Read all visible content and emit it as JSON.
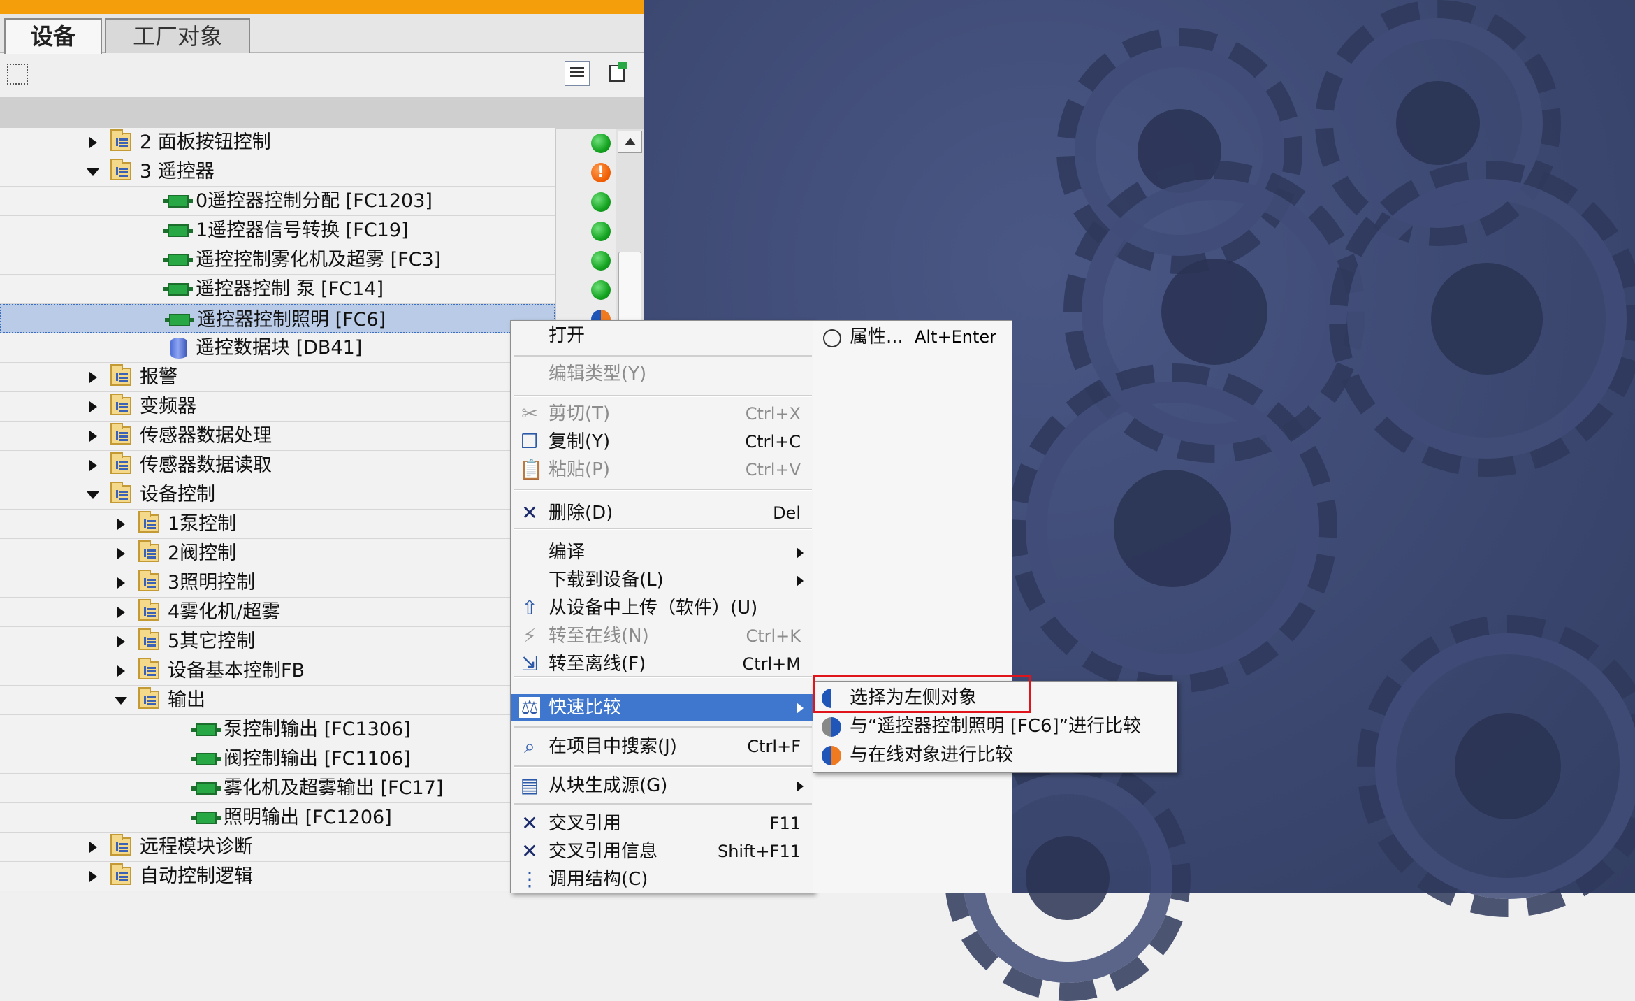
{
  "tabs": {
    "devices": "设备",
    "plant_objects": "工厂对象"
  },
  "tree": [
    {
      "label": "2 面板按钮控制",
      "kind": "folder",
      "level": 0,
      "expanded": false,
      "status": "ok"
    },
    {
      "label": "3 遥控器",
      "kind": "folder",
      "level": 0,
      "expanded": true,
      "status": "warning"
    },
    {
      "label": "0遥控器控制分配 [FC1203]",
      "kind": "fc",
      "level": 1,
      "status": "ok"
    },
    {
      "label": "1遥控器信号转换 [FC19]",
      "kind": "fc",
      "level": 1,
      "status": "ok"
    },
    {
      "label": "遥控控制雾化机及超雾 [FC3]",
      "kind": "fc",
      "level": 1,
      "status": "ok"
    },
    {
      "label": "遥控器控制 泵 [FC14]",
      "kind": "fc",
      "level": 1,
      "status": "ok"
    },
    {
      "label": "遥控器控制照明 [FC6]",
      "kind": "fc",
      "level": 1,
      "status": "half",
      "selected": true
    },
    {
      "label": "遥控数据块 [DB41]",
      "kind": "db",
      "level": 1
    },
    {
      "label": "报警",
      "kind": "folder",
      "level": 0,
      "expanded": false
    },
    {
      "label": "变频器",
      "kind": "folder",
      "level": 0,
      "expanded": false
    },
    {
      "label": "传感器数据处理",
      "kind": "folder",
      "level": 0,
      "expanded": false
    },
    {
      "label": "传感器数据读取",
      "kind": "folder",
      "level": 0,
      "expanded": false
    },
    {
      "label": "设备控制",
      "kind": "folder",
      "level": 0,
      "expanded": true
    },
    {
      "label": "1泵控制",
      "kind": "folder",
      "level": 1,
      "expanded": false
    },
    {
      "label": "2阀控制",
      "kind": "folder",
      "level": 1,
      "expanded": false
    },
    {
      "label": "3照明控制",
      "kind": "folder",
      "level": 1,
      "expanded": false
    },
    {
      "label": "4雾化机/超雾",
      "kind": "folder",
      "level": 1,
      "expanded": false
    },
    {
      "label": "5其它控制",
      "kind": "folder",
      "level": 1,
      "expanded": false
    },
    {
      "label": "设备基本控制FB",
      "kind": "folder",
      "level": 1,
      "expanded": false
    },
    {
      "label": "输出",
      "kind": "folder",
      "level": 1,
      "expanded": true
    },
    {
      "label": "泵控制输出 [FC1306]",
      "kind": "fc",
      "level": 2
    },
    {
      "label": "阀控制输出 [FC1106]",
      "kind": "fc",
      "level": 2
    },
    {
      "label": "雾化机及超雾输出 [FC17]",
      "kind": "fc",
      "level": 2
    },
    {
      "label": "照明输出 [FC1206]",
      "kind": "fc",
      "level": 2
    },
    {
      "label": "远程模块诊断",
      "kind": "folder",
      "level": 0,
      "expanded": false
    },
    {
      "label": "自动控制逻辑",
      "kind": "folder",
      "level": 0,
      "expanded": false
    }
  ],
  "context_menu": [
    {
      "label": "打开",
      "shortcut": "",
      "enabled": true
    },
    {
      "label": "编辑类型(Y)",
      "shortcut": "",
      "enabled": false
    },
    {
      "label": "剪切(T)",
      "shortcut": "Ctrl+X",
      "enabled": false,
      "icon": "scissors-icon"
    },
    {
      "label": "复制(Y)",
      "shortcut": "Ctrl+C",
      "enabled": true,
      "icon": "copy-icon"
    },
    {
      "label": "粘贴(P)",
      "shortcut": "Ctrl+V",
      "enabled": false,
      "icon": "paste-icon"
    },
    {
      "label": "删除(D)",
      "shortcut": "Del",
      "enabled": true,
      "icon": "delete-icon"
    },
    {
      "label": "编译",
      "shortcut": "",
      "enabled": true,
      "submenu": true
    },
    {
      "label": "下载到设备(L)",
      "shortcut": "",
      "enabled": true,
      "submenu": true
    },
    {
      "label": "从设备中上传（软件）(U)",
      "shortcut": "",
      "enabled": true,
      "icon": "upload-icon"
    },
    {
      "label": "转至在线(N)",
      "shortcut": "Ctrl+K",
      "enabled": false,
      "icon": "go-online-icon"
    },
    {
      "label": "转至离线(F)",
      "shortcut": "Ctrl+M",
      "enabled": true,
      "icon": "go-offline-icon"
    },
    {
      "label": "快速比较",
      "shortcut": "",
      "enabled": true,
      "submenu": true,
      "highlighted": true,
      "icon": "compare-scale-icon"
    },
    {
      "label": "在项目中搜索(J)",
      "shortcut": "Ctrl+F",
      "enabled": true,
      "icon": "search-project-icon"
    },
    {
      "label": "从块生成源(G)",
      "shortcut": "",
      "enabled": true,
      "submenu": true,
      "icon": "generate-source-icon"
    },
    {
      "label": "交叉引用",
      "shortcut": "F11",
      "enabled": true,
      "icon": "cross-reference-icon"
    },
    {
      "label": "交叉引用信息",
      "shortcut": "Shift+F11",
      "enabled": true,
      "icon": "cross-reference-info-icon"
    },
    {
      "label": "调用结构(C)",
      "shortcut": "",
      "enabled": true,
      "icon": "call-structure-icon"
    }
  ],
  "properties_item": {
    "label": "属性...",
    "shortcut": "Alt+Enter"
  },
  "compare_submenu": [
    {
      "label": "选择为左侧对象"
    },
    {
      "label": "与“遥控器控制照明 [FC6]”进行比较"
    },
    {
      "label": "与在线对象进行比较"
    }
  ],
  "colors": {
    "accent": "#3f77cf",
    "selection": "#b9cbe6",
    "highlight_box": "#e0151b",
    "orange_bar": "#f59e0b",
    "background": "#3b476f"
  }
}
